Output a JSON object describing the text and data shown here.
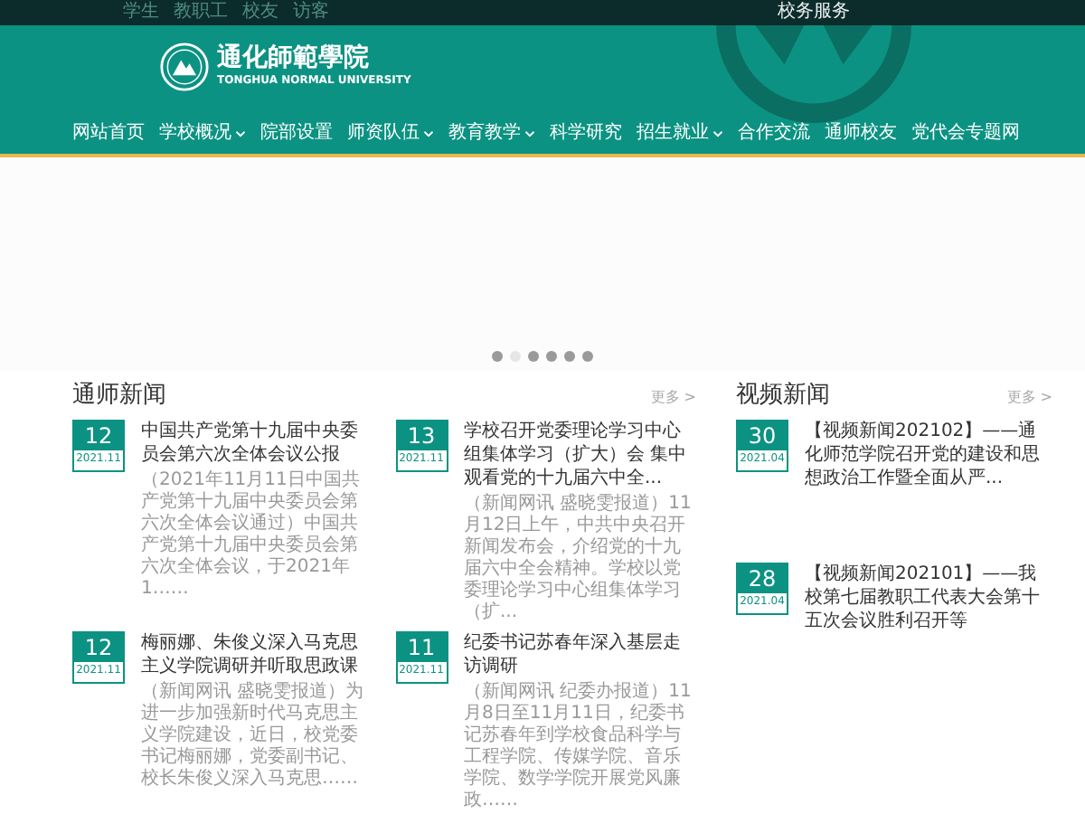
{
  "top_bar": {
    "links": [
      "学生",
      "教职工",
      "校友",
      "访客"
    ],
    "service": "校务服务"
  },
  "logo": {
    "name": "通化師範學院",
    "english": "TONGHUA NORMAL UNIVERSITY"
  },
  "nav": [
    {
      "label": "网站首页",
      "has_dropdown": false
    },
    {
      "label": "学校概况",
      "has_dropdown": true
    },
    {
      "label": "院部设置",
      "has_dropdown": false
    },
    {
      "label": "师资队伍",
      "has_dropdown": true
    },
    {
      "label": "教育教学",
      "has_dropdown": true
    },
    {
      "label": "科学研究",
      "has_dropdown": false
    },
    {
      "label": "招生就业",
      "has_dropdown": true
    },
    {
      "label": "合作交流",
      "has_dropdown": false
    },
    {
      "label": "通师校友",
      "has_dropdown": false
    },
    {
      "label": "党代会专题网",
      "has_dropdown": false
    }
  ],
  "carousel": {
    "dots": [
      {
        "selected": false
      },
      {
        "selected": true
      },
      {
        "selected": false
      },
      {
        "selected": false
      },
      {
        "selected": false
      },
      {
        "selected": false
      }
    ]
  },
  "news": {
    "title": "通师新闻",
    "more": "更多 >",
    "items": [
      {
        "day": "12",
        "month": "2021.11",
        "title": "中国共产党第十九届中央委员会第六次全体会议公报",
        "summary": "（2021年11月11日中国共产党第十九届中央委员会第六次全体会议通过）中国共产党第十九届中央委员会第六次全体会议，于2021年1……"
      },
      {
        "day": "13",
        "month": "2021.11",
        "title": "学校召开党委理论学习中心组集体学习（扩大）会 集中观看党的十九届六中全...",
        "summary": "（新闻网讯 盛晓雯报道）11月12日上午，中共中央召开新闻发布会，介绍党的十九届六中全会精神。学校以党委理论学习中心组集体学习（扩..."
      },
      {
        "day": "12",
        "month": "2021.11",
        "title": "梅丽娜、朱俊义深入马克思主义学院调研并听取思政课",
        "summary": "（新闻网讯 盛晓雯报道）为进一步加强新时代马克思主义学院建设，近日，校党委书记梅丽娜，党委副书记、校长朱俊义深入马克思……"
      },
      {
        "day": "11",
        "month": "2021.11",
        "title": "纪委书记苏春年深入基层走访调研",
        "summary": "（新闻网讯 纪委办报道）11月8日至11月11日，纪委书记苏春年到学校食品科学与工程学院、传媒学院、音乐学院、数学学院开展党风廉政……"
      }
    ]
  },
  "video": {
    "title": "视频新闻",
    "more": "更多 >",
    "items": [
      {
        "day": "30",
        "month": "2021.04",
        "title": "【视频新闻202102】——通化师范学院召开党的建设和思想政治工作暨全面从严..."
      },
      {
        "day": "28",
        "month": "2021.04",
        "title": "【视频新闻202101】——我校第七届教职工代表大会第十五次会议胜利召开等"
      }
    ]
  }
}
